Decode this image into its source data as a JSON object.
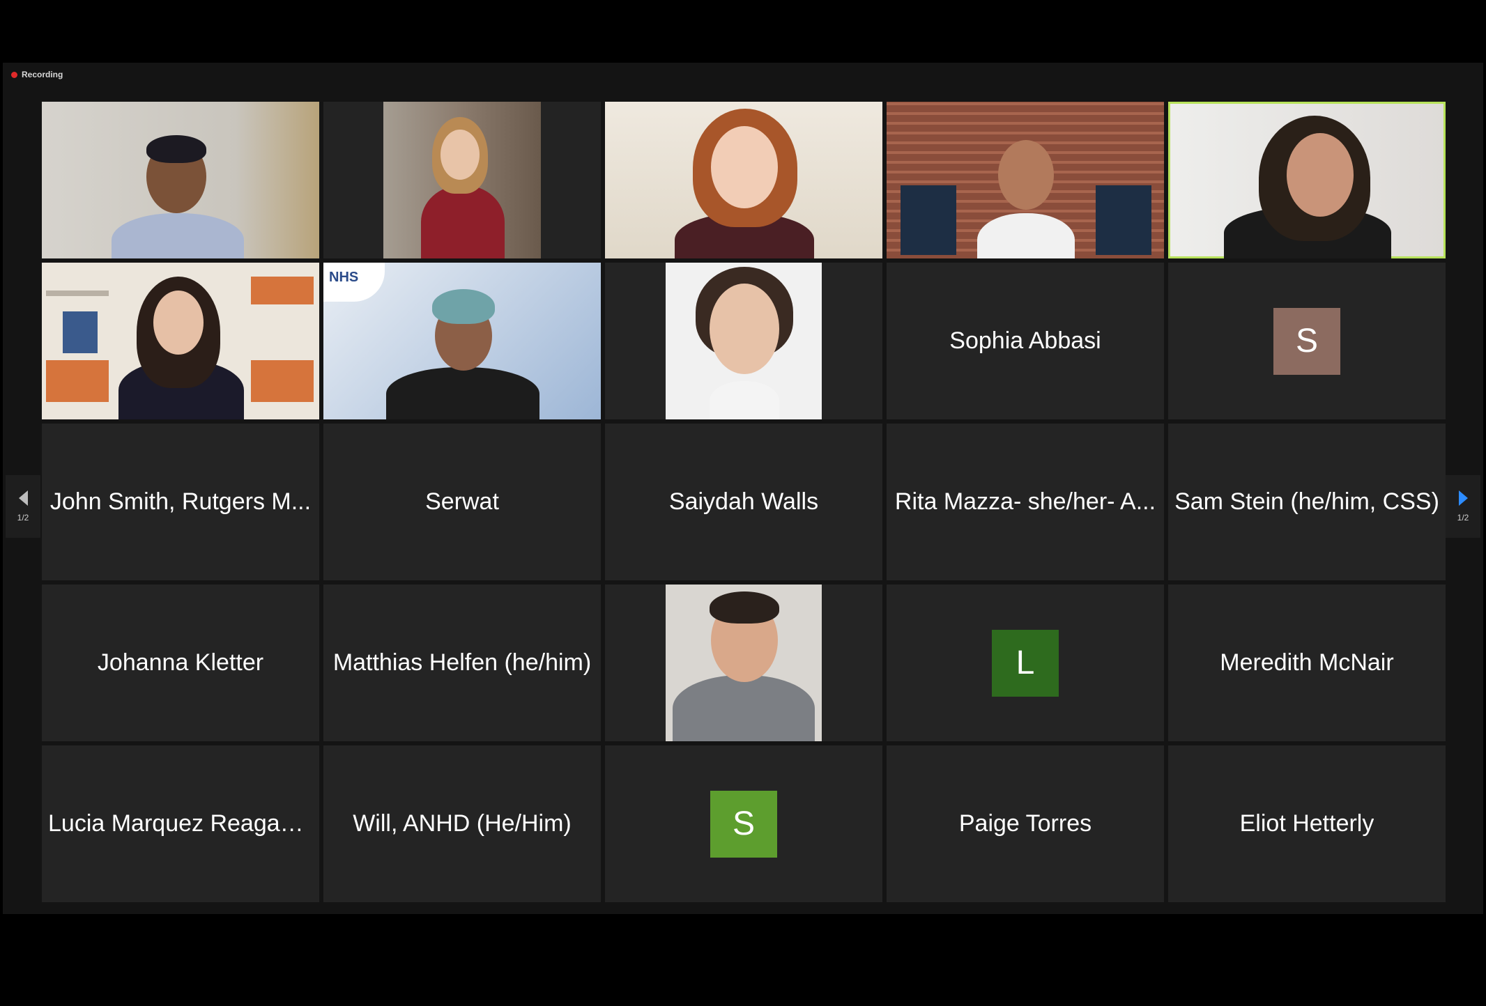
{
  "recording": {
    "label": "Recording",
    "color": "#e02a2a"
  },
  "pagination": {
    "left_page": "1/2",
    "right_page": "1/2",
    "accent": "#2d8cff"
  },
  "active_speaker_color": "#b7e25a",
  "participants": [
    {
      "type": "video",
      "name": ""
    },
    {
      "type": "video",
      "name": ""
    },
    {
      "type": "video",
      "name": ""
    },
    {
      "type": "video",
      "name": ""
    },
    {
      "type": "video",
      "name": "",
      "active": true
    },
    {
      "type": "video",
      "name": ""
    },
    {
      "type": "video",
      "name": "",
      "overlay_text": "NHS"
    },
    {
      "type": "photo",
      "name": ""
    },
    {
      "type": "name",
      "name": "Sophia Abbasi"
    },
    {
      "type": "avatar",
      "letter": "S",
      "color": "#8c6b60"
    },
    {
      "type": "name",
      "name": "John Smith, Rutgers M..."
    },
    {
      "type": "name",
      "name": "Serwat"
    },
    {
      "type": "name",
      "name": "Saiydah Walls"
    },
    {
      "type": "name",
      "name": "Rita Mazza- she/her- A..."
    },
    {
      "type": "name",
      "name": "Sam Stein (he/him, CSS)"
    },
    {
      "type": "name",
      "name": "Johanna Kletter"
    },
    {
      "type": "name",
      "name": "Matthias Helfen (he/him)"
    },
    {
      "type": "photo",
      "name": ""
    },
    {
      "type": "avatar",
      "letter": "L",
      "color": "#2e6b1e"
    },
    {
      "type": "name",
      "name": "Meredith McNair"
    },
    {
      "type": "name",
      "name": "Lucia Marquez Reagan,..."
    },
    {
      "type": "name",
      "name": "Will, ANHD (He/Him)"
    },
    {
      "type": "avatar",
      "letter": "S",
      "color": "#5d9e2e"
    },
    {
      "type": "name",
      "name": "Paige Torres"
    },
    {
      "type": "name",
      "name": "Eliot Hetterly"
    }
  ]
}
